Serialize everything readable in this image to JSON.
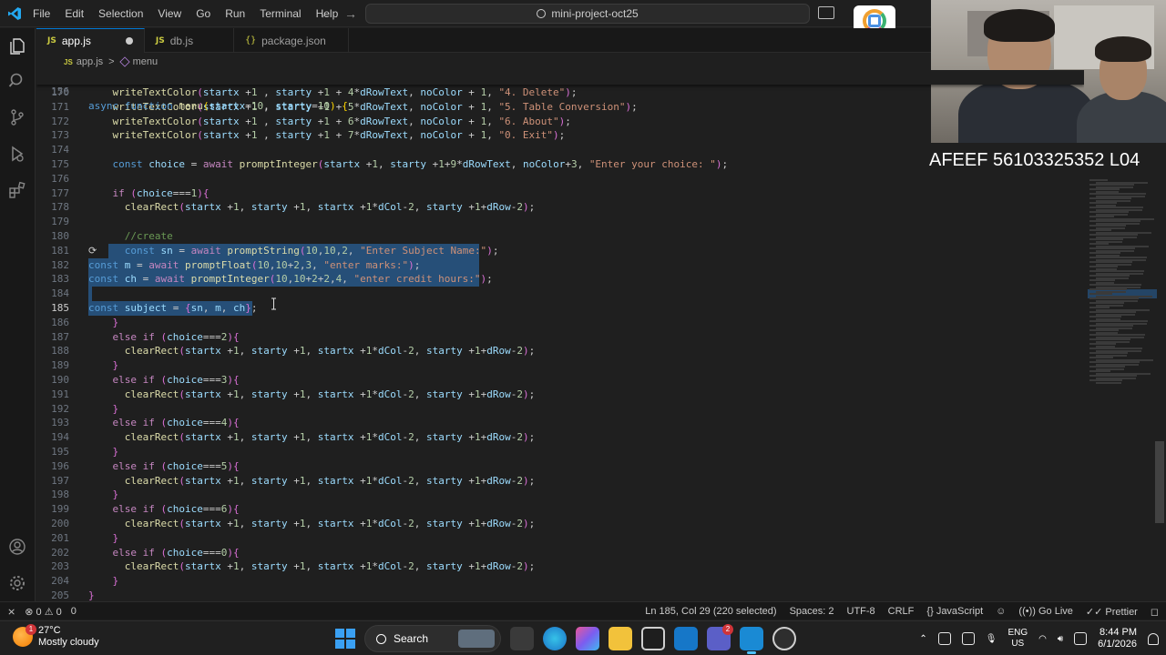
{
  "window": {
    "menu": [
      "File",
      "Edit",
      "Selection",
      "View",
      "Go",
      "Run",
      "Terminal",
      "Help"
    ],
    "search_text": "mini-project-oct25"
  },
  "tabs": [
    {
      "label": "app.js",
      "icon": "JS",
      "active": true,
      "modified": true
    },
    {
      "label": "db.js",
      "icon": "JS",
      "active": false
    },
    {
      "label": "package.json",
      "icon": "{}",
      "active": false
    }
  ],
  "breadcrumbs": {
    "file_icon": "JS",
    "file": "app.js",
    "separator": ">",
    "symbol": "menu"
  },
  "editor": {
    "current_line": "185",
    "sticky": {
      "num": "156",
      "code": "async function menu(startx=10, starty=10) {"
    },
    "lines": [
      {
        "num": "170",
        "code": "    writeTextColor(startx +1 , starty +1 + 4*dRowText, noColor + 1, \"4. Delete\");"
      },
      {
        "num": "171",
        "code": "    writeTextColor(startx +1 , starty +1 + 5*dRowText, noColor + 1, \"5. Table Conversion\");"
      },
      {
        "num": "172",
        "code": "    writeTextColor(startx +1 , starty +1 + 6*dRowText, noColor + 1, \"6. About\");"
      },
      {
        "num": "173",
        "code": "    writeTextColor(startx +1 , starty +1 + 7*dRowText, noColor + 1, \"0. Exit\");"
      },
      {
        "num": "174",
        "code": ""
      },
      {
        "num": "175",
        "code": "    const choice = await promptInteger(startx +1, starty +1+9*dRowText, noColor+3, \"Enter your choice: \");"
      },
      {
        "num": "176",
        "code": ""
      },
      {
        "num": "177",
        "code": "    if (choice===1){"
      },
      {
        "num": "178",
        "code": "      clearRect(startx +1, starty +1, startx +1*dCol-2, starty +1+dRow-2);"
      },
      {
        "num": "179",
        "code": ""
      },
      {
        "num": "180",
        "code": "      //create"
      },
      {
        "num": "181",
        "code": "      const sn = await promptString(10,10,2, \"Enter Subject Name:\");"
      },
      {
        "num": "182",
        "code": "const m = await promptFloat(10,10+2,3, \"enter marks:\");"
      },
      {
        "num": "183",
        "code": "const ch = await promptInteger(10,10+2+2,4, \"enter credit hours:\");"
      },
      {
        "num": "184",
        "code": ""
      },
      {
        "num": "185",
        "code": "const subject = {sn, m, ch};"
      },
      {
        "num": "186",
        "code": "    }"
      },
      {
        "num": "187",
        "code": "    else if (choice===2){"
      },
      {
        "num": "188",
        "code": "      clearRect(startx +1, starty +1, startx +1*dCol-2, starty +1+dRow-2);"
      },
      {
        "num": "189",
        "code": "    }"
      },
      {
        "num": "190",
        "code": "    else if (choice===3){"
      },
      {
        "num": "191",
        "code": "      clearRect(startx +1, starty +1, startx +1*dCol-2, starty +1+dRow-2);"
      },
      {
        "num": "192",
        "code": "    }"
      },
      {
        "num": "193",
        "code": "    else if (choice===4){"
      },
      {
        "num": "194",
        "code": "      clearRect(startx +1, starty +1, startx +1*dCol-2, starty +1+dRow-2);"
      },
      {
        "num": "195",
        "code": "    }"
      },
      {
        "num": "196",
        "code": "    else if (choice===5){"
      },
      {
        "num": "197",
        "code": "      clearRect(startx +1, starty +1, startx +1*dCol-2, starty +1+dRow-2);"
      },
      {
        "num": "198",
        "code": "    }"
      },
      {
        "num": "199",
        "code": "    else if (choice===6){"
      },
      {
        "num": "200",
        "code": "      clearRect(startx +1, starty +1, startx +1*dCol-2, starty +1+dRow-2);"
      },
      {
        "num": "201",
        "code": "    }"
      },
      {
        "num": "202",
        "code": "    else if (choice===0){"
      },
      {
        "num": "203",
        "code": "      clearRect(startx +1, starty +1, startx +1*dCol-2, starty +1+dRow-2);"
      },
      {
        "num": "204",
        "code": "    }"
      },
      {
        "num": "205",
        "code": "}"
      }
    ]
  },
  "overlay": {
    "watermark": "AFEEF 56103325352 L04"
  },
  "statusbar": {
    "errors": "0",
    "warnings": "0",
    "ports": "0",
    "position": "Ln 185, Col 29 (220 selected)",
    "spaces": "Spaces: 2",
    "encoding": "UTF-8",
    "eol": "CRLF",
    "language": "JavaScript",
    "golive": "Go Live",
    "prettier": "Prettier"
  },
  "taskbar": {
    "temperature": "27°C",
    "weather": "Mostly cloudy",
    "weather_badge": "1",
    "search": "Search",
    "teams_badge": "2",
    "lang1": "ENG",
    "lang2": "US",
    "time": "8:44 PM",
    "date": "6/1/2026"
  },
  "colors": {
    "accent": "#0078d4",
    "selection": "#264f78",
    "keyword": "#569cd6",
    "function": "#dcdcaa",
    "string": "#ce9178"
  }
}
